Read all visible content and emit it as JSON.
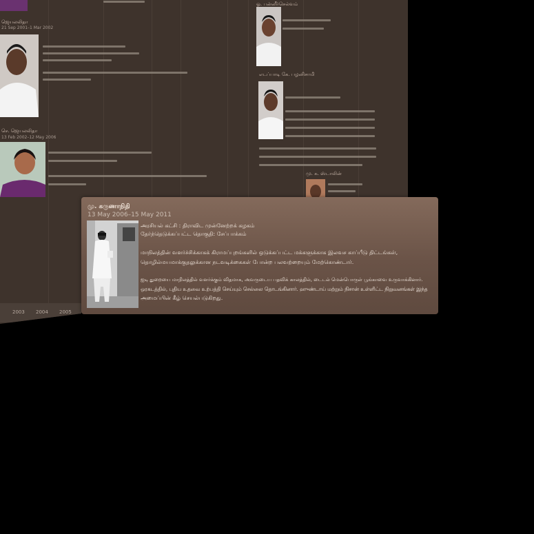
{
  "popup": {
    "name": "மு. கருணாநிதி",
    "date_range": "13 May 2006–15 May 2011",
    "party": "அரசியல் கட்சி : திராவிட முன்னேற்றக் கழகம்",
    "constituency": "தேர்ந்தெடுக்கப்பட்ட தொகுதி: சேப்பாக்கம்",
    "paragraph1_line1": "மாநிலத்தின் வளர்ச்சிக்காகக் கிராமப்புறங்களில் ஒடுக்கப்பட்ட மக்களுக்காக இலவச காப்பீடு திட்டங்கள்,",
    "paragraph1_line2": "தொழில்மயமாக்குதலுக்கான நடவடிக்கைகள் போன்ற பலவற்றையும் மேற்கொண்டார்.",
    "paragraph2_line1": "ஐடி துறையை மாநிலத்தில் வளர்க்கும் விதமாக, அவருடைய பதவிக் காலத்தில், டைடல் மென்பொருள் பூங்காவை உருவாக்கினார்.",
    "paragraph2_line2": "ஒரகடத்தில், புதிய உதவை உற்பத்தி செய்யும் செல்லை தொடங்கினார். ஹுண்டாய் மற்றும் நிசான் உள்ளிட்ட நிறுவனங்கள் இந்த",
    "paragraph2_line3": "அமைப்பின் கீழ் செயல்படுகிறது."
  },
  "timeline": {
    "card_left_top_name": "ஜெயலலிதா",
    "card_left_bottom_name": "செ. ஜெயலலிதா",
    "card_left_bottom_date": "13 Feb 2002–12 May 2006",
    "card_left_top_date": "21 Sep 2001–1 Mar 2002",
    "card_right_top_name": "ஓ. பன்னீர்செல்வம்",
    "card_right_mid_name": "எடப்பாடி கே. பழனிசாமி",
    "card_right_bottom_name": "மு. க. ஸ்டாலின்"
  },
  "axis": {
    "years": [
      "2003",
      "2004",
      "2005"
    ]
  },
  "colors": {
    "panel_bg": "#3e332c",
    "popup_bg": "#6a5347",
    "page_bg": "#000000"
  }
}
